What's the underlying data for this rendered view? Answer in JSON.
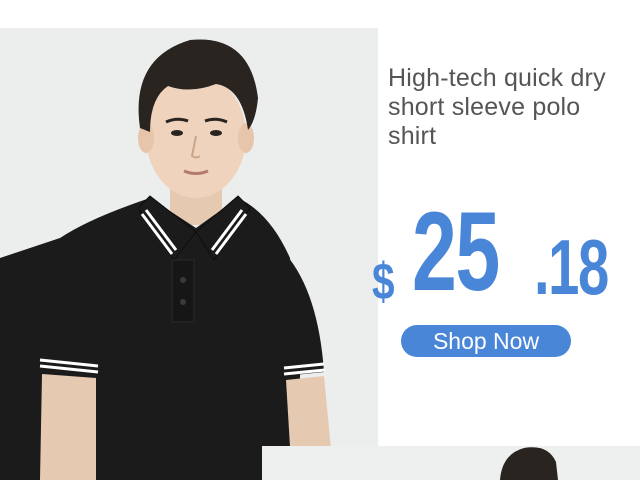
{
  "product": {
    "title": "High-tech quick dry short sleeve polo shirt",
    "price": {
      "currency": "$",
      "whole": "25",
      "cents": ".18"
    },
    "shop_button_label": "Shop Now",
    "image_alt": "Man wearing black polo shirt with white collar trim"
  },
  "colors": {
    "accent": "#4a86d8",
    "title_text": "#555555",
    "shirt": "#1b1b1b",
    "photo_bg": "#eceeee"
  }
}
